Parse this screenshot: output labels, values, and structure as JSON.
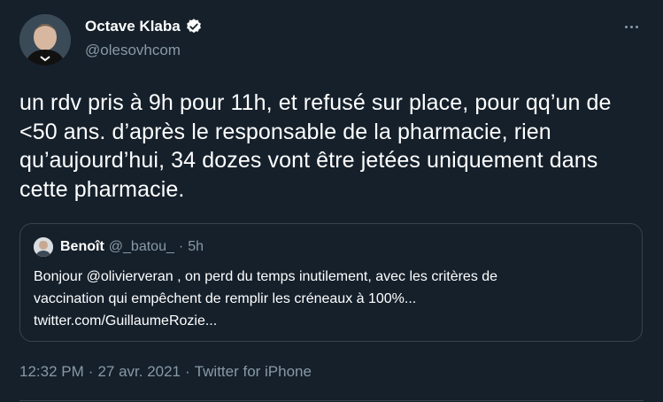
{
  "tweet": {
    "author_name": "Octave Klaba",
    "author_handle": "@olesovhcom",
    "verified": true,
    "text": "un rdv pris à 9h pour 11h, et refusé sur place, pour qq’un de <50 ans. d’après le responsable de la pharmacie, rien qu’aujourd’hui, 34 dozes vont être jetées uniquement dans cette pharmacie.",
    "time": "12:32 PM",
    "date": "27 avr. 2021",
    "source": "Twitter for iPhone",
    "separator": "·"
  },
  "quote": {
    "author_name": "Benoît",
    "author_handle": "@_batou_",
    "separator": "·",
    "age": "5h",
    "text_line1": "Bonjour @olivierveran , on perd du temps inutilement, avec les critères de",
    "text_line2": "vaccination qui empêchent de remplir les créneaux à 100%...",
    "text_line3": "twitter.com/GuillaumeRozie..."
  },
  "icons": {
    "verified": "verified-badge-icon",
    "more": "more-options-icon"
  },
  "colors": {
    "background": "#15202b",
    "muted": "#8899a6",
    "border": "#38444d",
    "text": "#ffffff"
  }
}
